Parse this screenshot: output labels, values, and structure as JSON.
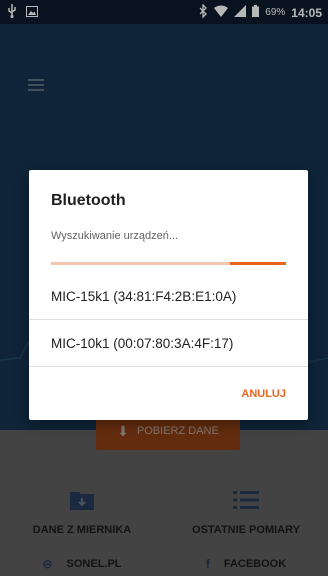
{
  "status_bar": {
    "battery_percent": "69%",
    "time": "14:05",
    "icons": [
      "usb-icon",
      "image-icon",
      "bluetooth-icon",
      "wifi-icon",
      "signal-icon",
      "battery-icon"
    ]
  },
  "app": {
    "fetch_button_label": "POBIERZ DANE",
    "tiles": [
      {
        "label": "DANE Z MIERNIKA",
        "icon": "folder-download-icon"
      },
      {
        "label": "OSTATNIE POMIARY",
        "icon": "list-icon"
      }
    ],
    "links": [
      {
        "label": "SONEL.PL",
        "icon": "link-icon"
      },
      {
        "label": "FACEBOOK",
        "icon": "facebook-icon"
      }
    ]
  },
  "dialog": {
    "title": "Bluetooth",
    "message": "Wyszukiwanie urządzeń...",
    "progress": 0.24,
    "devices": [
      "MIC-15k1 (34:81:F4:2B:E1:0A)",
      "MIC-10k1 (00:07:80:3A:4F:17)"
    ],
    "cancel_label": "ANULUJ"
  },
  "colors": {
    "accent": "#e8631f",
    "app_dark": "#16324f",
    "fetch_button": "#8a3d14"
  }
}
